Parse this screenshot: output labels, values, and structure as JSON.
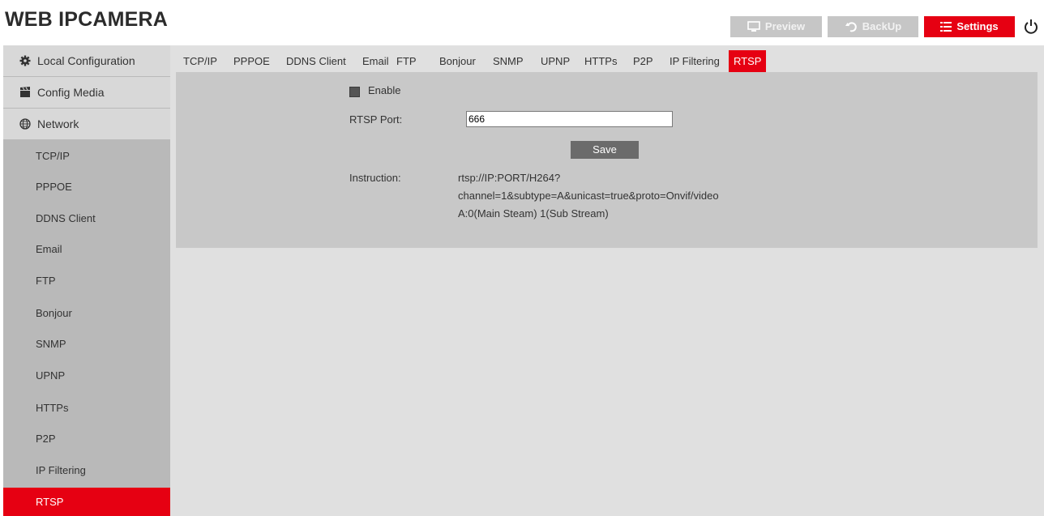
{
  "app": {
    "title": "WEB IPCAMERA",
    "accent": "#e60012"
  },
  "topnav": {
    "preview": {
      "label": "Preview",
      "icon": "monitor-icon"
    },
    "backup": {
      "label": "BackUp",
      "icon": "undo-icon"
    },
    "settings": {
      "label": "Settings",
      "icon": "list-icon"
    },
    "power": {
      "icon": "power-icon"
    }
  },
  "sidebar": {
    "sections": [
      {
        "label": "Local Configuration",
        "icon": "gear-icon"
      },
      {
        "label": "Config Media",
        "icon": "clapperboard-icon"
      },
      {
        "label": "Network",
        "icon": "globe-icon"
      }
    ],
    "network_items": [
      "TCP/IP",
      "PPPOE",
      "DDNS Client",
      "Email",
      "FTP",
      "Bonjour",
      "SNMP",
      "UPNP",
      "HTTPs",
      "P2P",
      "IP Filtering",
      "RTSP"
    ],
    "active_item": "RTSP"
  },
  "tabs": {
    "items": [
      "TCP/IP",
      "PPPOE",
      "DDNS Client",
      "Email",
      "FTP",
      "Bonjour",
      "SNMP",
      "UPNP",
      "HTTPs",
      "P2P",
      "IP Filtering",
      "RTSP"
    ],
    "active": "RTSP"
  },
  "rtsp": {
    "enable_label": "Enable",
    "enabled": true,
    "port_label": "RTSP Port:",
    "port_value": "666",
    "save_label": "Save",
    "instruction_label": "Instruction:",
    "instruction_lines": [
      "rtsp://IP:PORT/H264?",
      "channel=1&subtype=A&unicast=true&proto=Onvif/video",
      "A:0(Main Steam) 1(Sub Stream)"
    ]
  }
}
